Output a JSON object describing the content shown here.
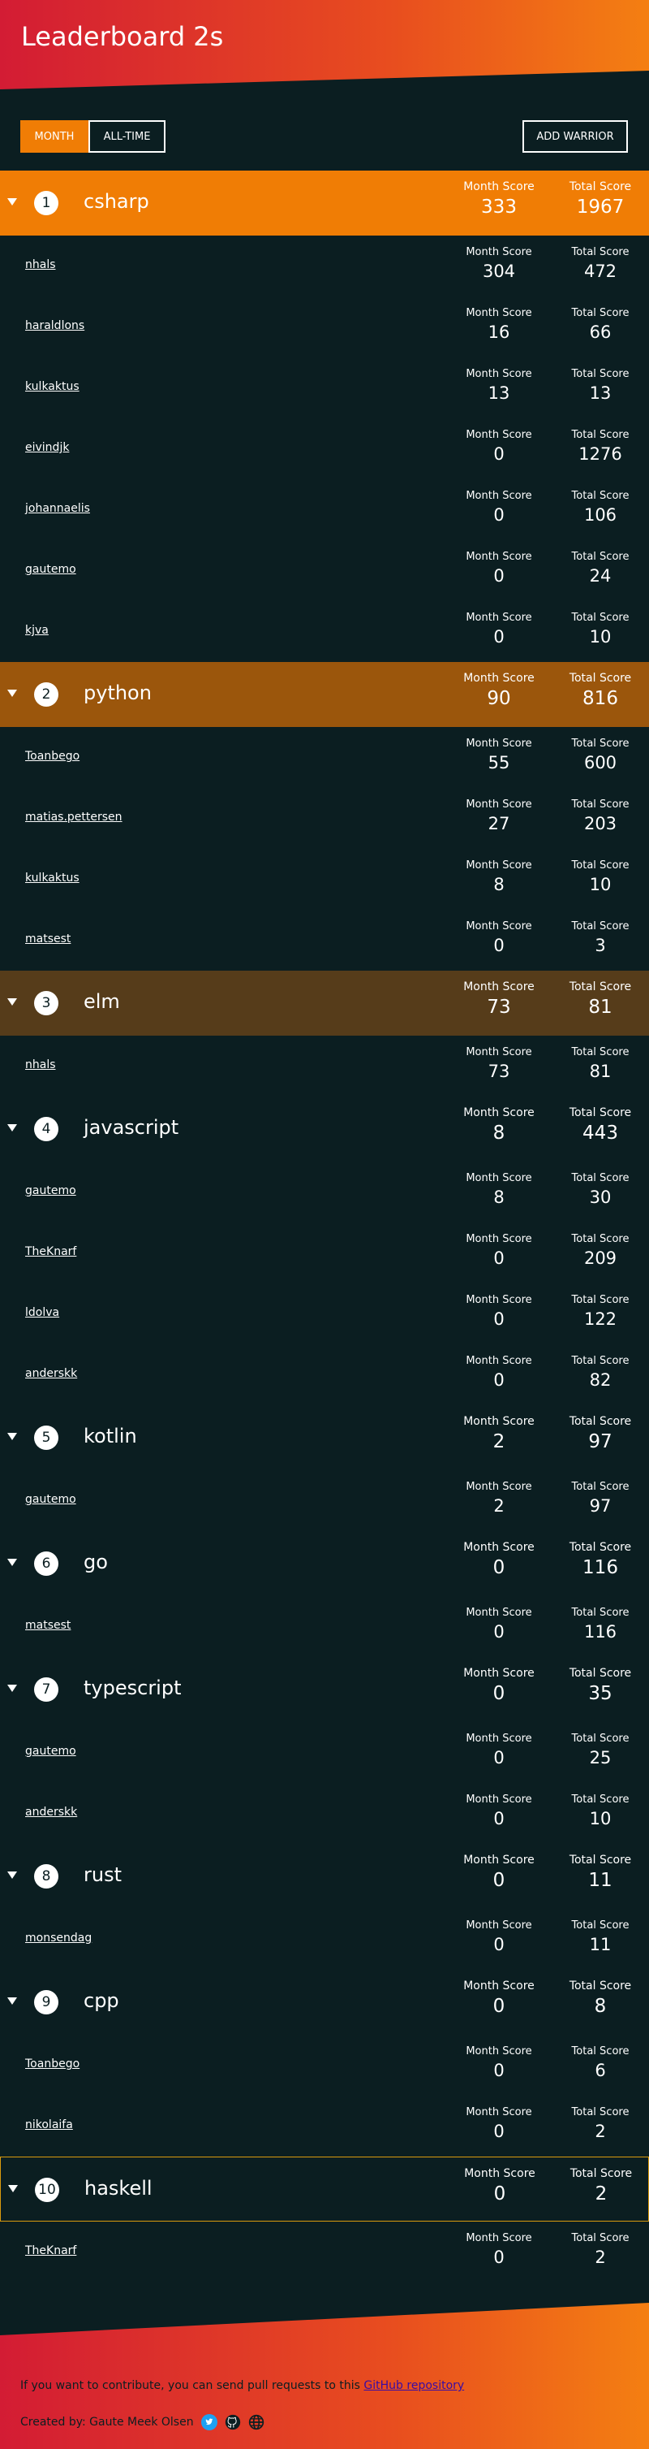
{
  "header": {
    "title": "Leaderboard 2s"
  },
  "toolbar": {
    "month_label": "MONTH",
    "alltime_label": "ALL-TIME",
    "add_label": "ADD WARRIOR"
  },
  "labels": {
    "month_score": "Month Score",
    "total_score": "Total Score"
  },
  "colors": {
    "accent": "#f07d05",
    "background": "#0b1e21",
    "header_from": "#d31c34",
    "header_to": "#f47f12"
  },
  "groups": [
    {
      "rank": "1",
      "name": "csharp",
      "month": "333",
      "total": "1967",
      "color": "#f07d05",
      "users": [
        {
          "name": "nhals",
          "month": "304",
          "total": "472"
        },
        {
          "name": "haraldlons",
          "month": "16",
          "total": "66"
        },
        {
          "name": "kulkaktus",
          "month": "13",
          "total": "13"
        },
        {
          "name": "eivindjk",
          "month": "0",
          "total": "1276"
        },
        {
          "name": "johannaelis",
          "month": "0",
          "total": "106"
        },
        {
          "name": "gautemo",
          "month": "0",
          "total": "24"
        },
        {
          "name": "kjva",
          "month": "0",
          "total": "10"
        }
      ]
    },
    {
      "rank": "2",
      "name": "python",
      "month": "90",
      "total": "816",
      "color": "#9b560c",
      "users": [
        {
          "name": "Toanbego",
          "month": "55",
          "total": "600"
        },
        {
          "name": "matias.pettersen",
          "month": "27",
          "total": "203"
        },
        {
          "name": "kulkaktus",
          "month": "8",
          "total": "10"
        },
        {
          "name": "matsest",
          "month": "0",
          "total": "3"
        }
      ]
    },
    {
      "rank": "3",
      "name": "elm",
      "month": "73",
      "total": "81",
      "color": "#563c1a",
      "users": [
        {
          "name": "nhals",
          "month": "73",
          "total": "81"
        }
      ]
    },
    {
      "rank": "4",
      "name": "javascript",
      "month": "8",
      "total": "443",
      "color": "",
      "users": [
        {
          "name": "gautemo",
          "month": "8",
          "total": "30"
        },
        {
          "name": "TheKnarf",
          "month": "0",
          "total": "209"
        },
        {
          "name": "ldolva",
          "month": "0",
          "total": "122"
        },
        {
          "name": "anderskk",
          "month": "0",
          "total": "82"
        }
      ]
    },
    {
      "rank": "5",
      "name": "kotlin",
      "month": "2",
      "total": "97",
      "color": "",
      "users": [
        {
          "name": "gautemo",
          "month": "2",
          "total": "97"
        }
      ]
    },
    {
      "rank": "6",
      "name": "go",
      "month": "0",
      "total": "116",
      "color": "",
      "users": [
        {
          "name": "matsest",
          "month": "0",
          "total": "116"
        }
      ]
    },
    {
      "rank": "7",
      "name": "typescript",
      "month": "0",
      "total": "35",
      "color": "",
      "users": [
        {
          "name": "gautemo",
          "month": "0",
          "total": "25"
        },
        {
          "name": "anderskk",
          "month": "0",
          "total": "10"
        }
      ]
    },
    {
      "rank": "8",
      "name": "rust",
      "month": "0",
      "total": "11",
      "color": "",
      "users": [
        {
          "name": "monsendag",
          "month": "0",
          "total": "11"
        }
      ]
    },
    {
      "rank": "9",
      "name": "cpp",
      "month": "0",
      "total": "8",
      "color": "",
      "users": [
        {
          "name": "Toanbego",
          "month": "0",
          "total": "6"
        },
        {
          "name": "nikolaifa",
          "month": "0",
          "total": "2"
        }
      ]
    },
    {
      "rank": "10",
      "name": "haskell",
      "month": "0",
      "total": "2",
      "color": "",
      "highlighted": true,
      "users": [
        {
          "name": "TheKnarf",
          "month": "0",
          "total": "2"
        }
      ]
    }
  ],
  "footer": {
    "contrib_text": "If you want to contribute, you can send pull requests to this",
    "repo_link": "GitHub repository",
    "created_by": "Created by: Gaute Meek Olsen",
    "icons": [
      "twitter-icon",
      "github-icon",
      "globe-icon"
    ]
  }
}
